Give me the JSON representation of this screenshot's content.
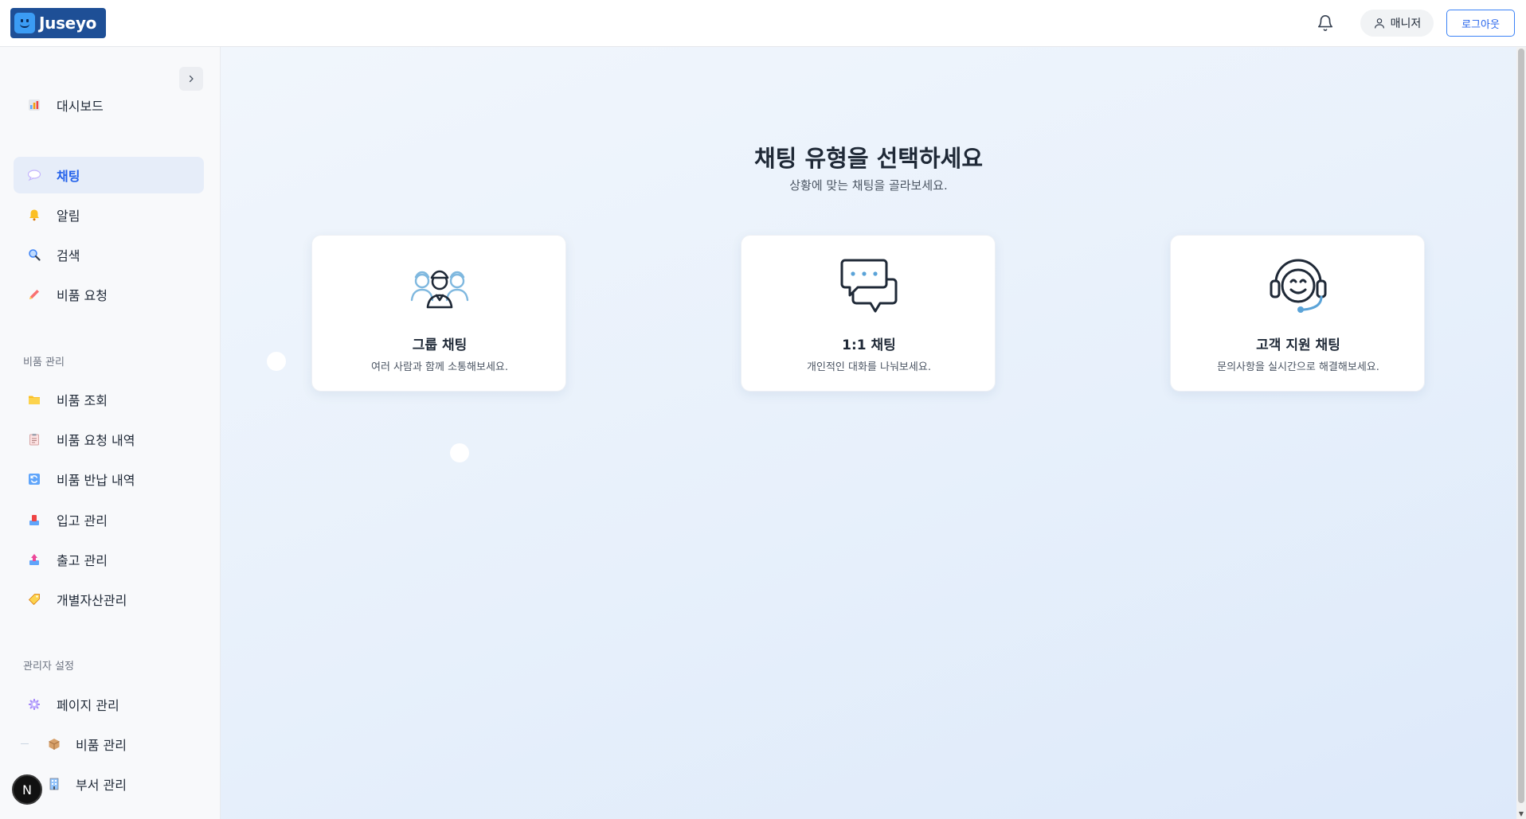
{
  "header": {
    "logo_text": "Juseyo",
    "user_label": "매니저",
    "logout_label": "로그아웃",
    "bell_icon": "bell-icon",
    "user_icon": "user-icon"
  },
  "sidebar": {
    "main_items": [
      {
        "label": "대시보드",
        "icon": "bar-chart-icon"
      },
      {
        "label": "채팅",
        "icon": "speech-bubble-icon"
      },
      {
        "label": "알림",
        "icon": "bell-icon"
      },
      {
        "label": "검색",
        "icon": "magnifier-icon"
      },
      {
        "label": "비품 요청",
        "icon": "pencil-icon"
      }
    ],
    "section_supplies": "비품 관리",
    "supplies_items": [
      {
        "label": "비품 조회",
        "icon": "folder-icon"
      },
      {
        "label": "비품 요청 내역",
        "icon": "clipboard-icon"
      },
      {
        "label": "비품 반납 내역",
        "icon": "refresh-icon"
      },
      {
        "label": "입고 관리",
        "icon": "inbox-tray-icon"
      },
      {
        "label": "출고 관리",
        "icon": "outbox-tray-icon"
      },
      {
        "label": "개별자산관리",
        "icon": "tag-icon"
      }
    ],
    "section_admin": "관리자 설정",
    "admin_items": [
      {
        "label": "페이지 관리",
        "icon": "gear-icon"
      },
      {
        "label": "비품 관리",
        "icon": "package-icon"
      },
      {
        "label": "부서 관리",
        "icon": "building-icon"
      }
    ],
    "active_index": 1
  },
  "main": {
    "title": "채팅 유형을 선택하세요",
    "subtitle": "상황에 맞는 채팅을 골라보세요.",
    "cards": [
      {
        "title": "그룹 채팅",
        "desc": "여러 사람과 함께 소통해보세요.",
        "icon": "group-people-icon"
      },
      {
        "title": "1:1 채팅",
        "desc": "개인적인 대화를 나눠보세요.",
        "icon": "chat-bubbles-icon"
      },
      {
        "title": "고객 지원 채팅",
        "desc": "문의사항을 실시간으로 해결해보세요.",
        "icon": "headset-support-icon"
      }
    ]
  },
  "floating_badge": "N",
  "colors": {
    "brand": "#1e4f96",
    "accent": "#2563eb",
    "active_bg": "#e6edf9"
  }
}
